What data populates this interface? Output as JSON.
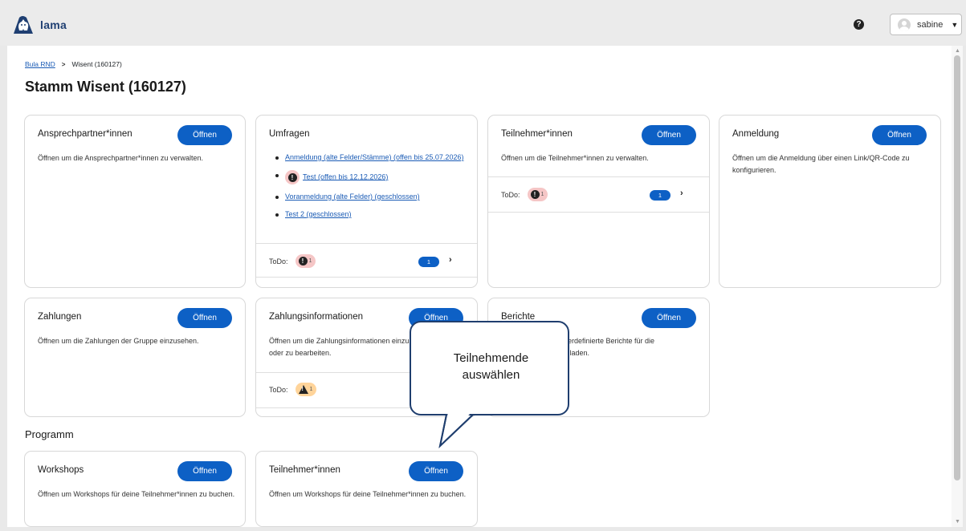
{
  "header": {
    "logo_text": "lama",
    "help_glyph": "?",
    "user_name": "sabine"
  },
  "breadcrumb": {
    "parent": "Bula RND",
    "separator": ">",
    "current": "Wisent (160127)"
  },
  "page_title": "Stamm Wisent (160127)",
  "open_label": "Öffnen",
  "todo_label": "ToDo:",
  "cards": {
    "contacts": {
      "title": "Ansprechpartner*innen",
      "desc": "Öffnen um die Ansprechpartner*innen zu verwalten."
    },
    "surveys": {
      "title": "Umfragen",
      "items": [
        "Anmeldung (alte Felder/Stämme) (offen bis 25.07.2026)",
        "Test (offen bis 12.12.2026)",
        "Voranmeldung (alte Felder) (geschlossen)",
        "Test 2 (geschlossen)"
      ],
      "todo_count": "1",
      "pill_count": "1"
    },
    "participants": {
      "title": "Teilnehmer*innen",
      "desc": "Öffnen um die Teilnehmer*innen zu verwalten.",
      "todo_count": "1",
      "pill_count": "1"
    },
    "registration": {
      "title": "Anmeldung",
      "desc": "Öffnen um die Anmeldung über einen Link/QR-Code zu konfigurieren."
    },
    "payments": {
      "title": "Zahlungen",
      "desc": "Öffnen um die Zahlungen der Gruppe einzusehen."
    },
    "payment_info": {
      "title": "Zahlungsinformationen",
      "desc": "Öffnen um die Zahlungsinformationen einzusehen oder zu bearbeiten.",
      "todo_count": "1"
    },
    "reports": {
      "title": "Berichte",
      "desc": "erdefinierte Berichte für die",
      "desc2": "ıladen."
    }
  },
  "program": {
    "section_title": "Programm",
    "workshops": {
      "title": "Workshops",
      "desc": "Öffnen um Workshops für deine Teilnehmer*innen zu buchen."
    },
    "participants": {
      "title": "Teilnehmer*innen",
      "desc": "Öffnen um Workshops für deine Teilnehmer*innen zu buchen."
    }
  },
  "callout": {
    "line1": "Teilnehmende",
    "line2": "auswählen"
  },
  "colors": {
    "primary": "#0d60c5",
    "link": "#1a5bb5",
    "alert_bg": "#f5c6c6",
    "warning_bg": "#ffd49a",
    "callout_border": "#1f3e6e"
  },
  "icons": [
    "lama-logo-icon",
    "help-icon",
    "avatar-icon",
    "caret-down-icon",
    "chevron-right-icon",
    "exclamation-icon",
    "warning-icon"
  ]
}
